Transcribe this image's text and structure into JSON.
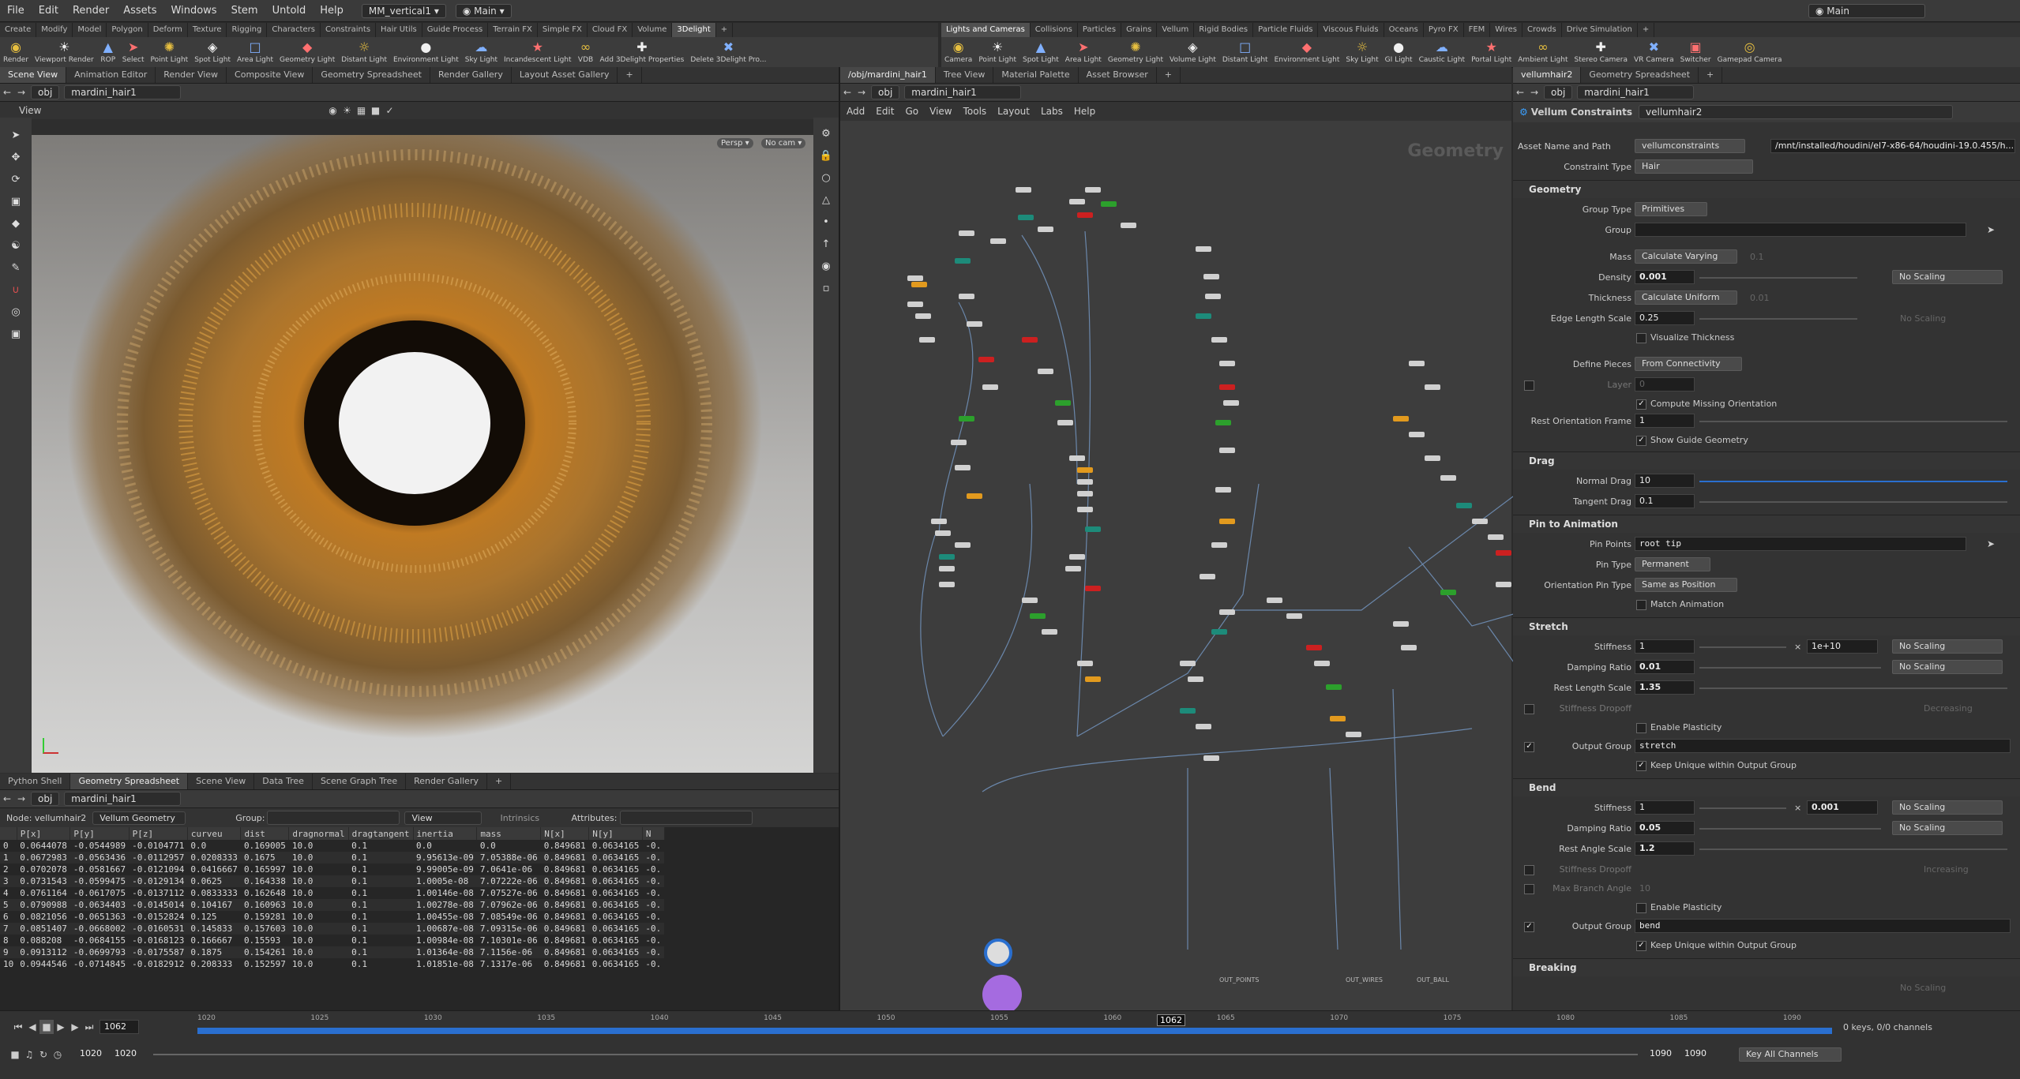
{
  "menubar": {
    "items": [
      "File",
      "Edit",
      "Render",
      "Assets",
      "Windows",
      "Stem",
      "Untold",
      "Help"
    ],
    "desktop": "MM_vertical1",
    "network": "Main",
    "right_network": "Main"
  },
  "shelf_left": {
    "tabs": [
      "Create",
      "Modify",
      "Model",
      "Polygon",
      "Deform",
      "Texture",
      "Rigging",
      "Characters",
      "Constraints",
      "Hair Utils",
      "Guide Process",
      "Terrain FX",
      "Simple FX",
      "Cloud FX",
      "Volume",
      "3Delight"
    ],
    "active": "3Delight",
    "tools": [
      "Render",
      "Viewport Render",
      "ROP",
      "Select",
      "Point Light",
      "Spot Light",
      "Area Light",
      "Geometry Light",
      "Distant Light",
      "Environment Light",
      "Sky Light",
      "Incandescent Light",
      "VDB",
      "Add 3Delight Properties",
      "Delete 3Delight Pro..."
    ]
  },
  "shelf_right": {
    "tabs": [
      "Lights and Cameras",
      "Collisions",
      "Particles",
      "Grains",
      "Vellum",
      "Rigid Bodies",
      "Particle Fluids",
      "Viscous Fluids",
      "Oceans",
      "Pyro FX",
      "FEM",
      "Wires",
      "Crowds",
      "Drive Simulation"
    ],
    "active": "Lights and Cameras",
    "tools": [
      "Camera",
      "Point Light",
      "Spot Light",
      "Area Light",
      "Geometry Light",
      "Volume Light",
      "Distant Light",
      "Environment Light",
      "Sky Light",
      "GI Light",
      "Caustic Light",
      "Portal Light",
      "Ambient Light",
      "Stereo Camera",
      "VR Camera",
      "Switcher",
      "Gamepad Camera"
    ]
  },
  "viewport": {
    "tabs": [
      "Scene View",
      "Animation Editor",
      "Render View",
      "Composite View",
      "Geometry Spreadsheet",
      "Render Gallery",
      "Layout Asset Gallery"
    ],
    "path_root": "obj",
    "path_node": "mardini_hair1",
    "view_label": "View",
    "persp": "Persp ▾",
    "cam": "No cam ▾"
  },
  "network": {
    "tabs": [
      "/obj/mardini_hair1",
      "Tree View",
      "Material Palette",
      "Asset Browser"
    ],
    "path_root": "obj",
    "path_node": "mardini_hair1",
    "menu": [
      "Add",
      "Edit",
      "Go",
      "View",
      "Tools",
      "Layout",
      "Labs",
      "Help"
    ],
    "watermark": "Geometry",
    "out_labels": [
      "OUT_POINTS",
      "OUT_WIRES",
      "OUT_BALL"
    ]
  },
  "spreadsheet": {
    "tabs": [
      "Python Shell",
      "Geometry Spreadsheet",
      "Scene View",
      "Data Tree",
      "Scene Graph Tree",
      "Render Gallery"
    ],
    "path_root": "obj",
    "path_node": "mardini_hair1",
    "node_label": "Node: vellumhair2",
    "geom_select": "Vellum Geometry",
    "group_label": "Group:",
    "view_label": "View",
    "intrinsics": "Intrinsics",
    "attributes_label": "Attributes:",
    "columns": [
      "",
      "P[x]",
      "P[y]",
      "P[z]",
      "curveu",
      "dist",
      "dragnormal",
      "dragtangent",
      "inertia",
      "mass",
      "N[x]",
      "N[y]",
      "N"
    ],
    "rows": [
      [
        "0",
        "0.0644078",
        "-0.0544989",
        "-0.0104771",
        "0.0",
        "0.169005",
        "10.0",
        "0.1",
        "0.0",
        "0.0",
        "0.849681",
        "0.0634165",
        "-0."
      ],
      [
        "1",
        "0.0672983",
        "-0.0563436",
        "-0.0112957",
        "0.0208333",
        "0.1675",
        "10.0",
        "0.1",
        "9.95613e-09",
        "7.05388e-06",
        "0.849681",
        "0.0634165",
        "-0."
      ],
      [
        "2",
        "0.0702078",
        "-0.0581667",
        "-0.0121094",
        "0.0416667",
        "0.165997",
        "10.0",
        "0.1",
        "9.99005e-09",
        "7.0641e-06",
        "0.849681",
        "0.0634165",
        "-0."
      ],
      [
        "3",
        "0.0731543",
        "-0.0599475",
        "-0.0129134",
        "0.0625",
        "0.164338",
        "10.0",
        "0.1",
        "1.0005e-08",
        "7.07222e-06",
        "0.849681",
        "0.0634165",
        "-0."
      ],
      [
        "4",
        "0.0761164",
        "-0.0617075",
        "-0.0137112",
        "0.0833333",
        "0.162648",
        "10.0",
        "0.1",
        "1.00146e-08",
        "7.07527e-06",
        "0.849681",
        "0.0634165",
        "-0."
      ],
      [
        "5",
        "0.0790988",
        "-0.0634403",
        "-0.0145014",
        "0.104167",
        "0.160963",
        "10.0",
        "0.1",
        "1.00278e-08",
        "7.07962e-06",
        "0.849681",
        "0.0634165",
        "-0."
      ],
      [
        "6",
        "0.0821056",
        "-0.0651363",
        "-0.0152824",
        "0.125",
        "0.159281",
        "10.0",
        "0.1",
        "1.00455e-08",
        "7.08549e-06",
        "0.849681",
        "0.0634165",
        "-0."
      ],
      [
        "7",
        "0.0851407",
        "-0.0668002",
        "-0.0160531",
        "0.145833",
        "0.157603",
        "10.0",
        "0.1",
        "1.00687e-08",
        "7.09315e-06",
        "0.849681",
        "0.0634165",
        "-0."
      ],
      [
        "8",
        "0.088208",
        "-0.0684155",
        "-0.0168123",
        "0.166667",
        "0.15593",
        "10.0",
        "0.1",
        "1.00984e-08",
        "7.10301e-06",
        "0.849681",
        "0.0634165",
        "-0."
      ],
      [
        "9",
        "0.0913112",
        "-0.0699793",
        "-0.0175587",
        "0.1875",
        "0.154261",
        "10.0",
        "0.1",
        "1.01364e-08",
        "7.1156e-06",
        "0.849681",
        "0.0634165",
        "-0."
      ],
      [
        "10",
        "0.0944546",
        "-0.0714845",
        "-0.0182912",
        "0.208333",
        "0.152597",
        "10.0",
        "0.1",
        "1.01851e-08",
        "7.1317e-06",
        "0.849681",
        "0.0634165",
        "-0."
      ]
    ]
  },
  "params": {
    "tabs": [
      "vellumhair2",
      "Geometry Spreadsheet"
    ],
    "path_root": "obj",
    "path_node": "mardini_hair1",
    "node_type": "Vellum Constraints",
    "node_name": "vellumhair2",
    "asset_label": "Asset Name and Path",
    "asset_name": "vellumconstraints",
    "asset_path": "/mnt/installed/houdini/el7-x86-64/houdini-19.0.455/h...",
    "constraint_type_label": "Constraint Type",
    "constraint_type": "Hair",
    "geometry_section": "Geometry",
    "group_type_label": "Group Type",
    "group_type": "Primitives",
    "group_label": "Group",
    "mass_label": "Mass",
    "mass_mode": "Calculate Varying",
    "mass_value": "0.1",
    "density_label": "Density",
    "density": "0.001",
    "density_scaling": "No Scaling",
    "thickness_label": "Thickness",
    "thickness_mode": "Calculate Uniform",
    "thickness_value": "0.01",
    "edge_label": "Edge Length Scale",
    "edge": "0.25",
    "edge_scaling": "No Scaling",
    "visualize_thickness": "Visualize Thickness",
    "define_pieces_label": "Define Pieces",
    "define_pieces": "From Connectivity",
    "layer_label": "Layer",
    "layer": "0",
    "compute_orient": "Compute Missing Orientation",
    "rest_orient_label": "Rest Orientation Frame",
    "rest_orient": "1",
    "show_guide": "Show Guide Geometry",
    "drag_section": "Drag",
    "normal_drag_label": "Normal Drag",
    "normal_drag": "10",
    "tangent_drag_label": "Tangent Drag",
    "tangent_drag": "0.1",
    "pin_section": "Pin to Animation",
    "pin_points_label": "Pin Points",
    "pin_points": "root tip",
    "pin_type_label": "Pin Type",
    "pin_type": "Permanent",
    "orient_pin_label": "Orientation Pin Type",
    "orient_pin": "Same as Position",
    "match_anim": "Match Animation",
    "stretch_section": "Stretch",
    "stiffness_label": "Stiffness",
    "s_stiffness": "1",
    "s_stiffness_mult": "1e+10",
    "s_stiffness_scaling": "No Scaling",
    "damping_label": "Damping Ratio",
    "s_damping": "0.01",
    "s_damping_scaling": "No Scaling",
    "rest_length_label": "Rest Length Scale",
    "s_rest": "1.35",
    "stiffness_dropoff_label": "Stiffness Dropoff",
    "s_dropoff": "Decreasing",
    "enable_plasticity": "Enable Plasticity",
    "output_group_label": "Output Group",
    "s_output": "stretch",
    "keep_unique": "Keep Unique within Output Group",
    "bend_section": "Bend",
    "b_stiffness": "1",
    "b_stiffness_mult": "0.001",
    "b_stiffness_scaling": "No Scaling",
    "b_damping": "0.05",
    "b_damping_scaling": "No Scaling",
    "rest_angle_label": "Rest Angle Scale",
    "b_rest": "1.2",
    "b_dropoff": "Increasing",
    "max_branch_label": "Max Branch Angle",
    "max_branch": "10",
    "b_output": "bend",
    "breaking_section": "Breaking",
    "no_scaling_ghost": "No Scaling"
  },
  "timeline": {
    "frame": "1062",
    "frame_marker": "1062",
    "start": "1020",
    "start2": "1020",
    "end": "1090",
    "end2": "1090",
    "ticks": [
      "1020",
      "1025",
      "1030",
      "1035",
      "1040",
      "1045",
      "1050",
      "1055",
      "1060",
      "1065",
      "1070",
      "1075",
      "1080",
      "1085",
      "1090"
    ],
    "keys": "0 keys, 0/0 channels",
    "key_all": "Key All Channels"
  },
  "colors": {
    "accent": "#2a6fcf",
    "teal": "#1d8b7a",
    "red": "#cc2020",
    "green": "#2ca02c",
    "orange": "#e29a1e",
    "purple": "#a56be0"
  }
}
